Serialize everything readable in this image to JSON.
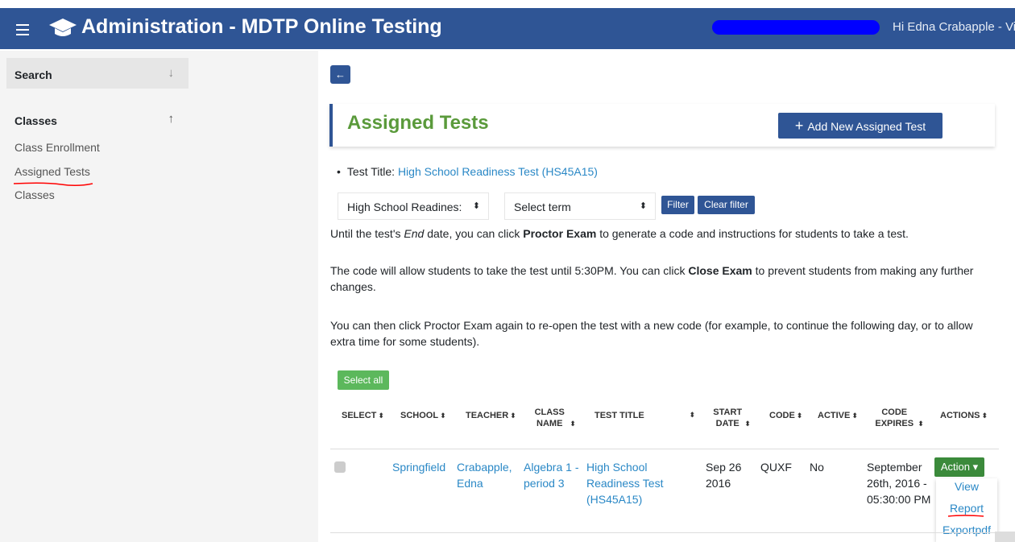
{
  "header": {
    "title": "Administration - MDTP Online Testing",
    "greeting": "Hi Edna Crabapple - Vi"
  },
  "sidebar": {
    "search_label": "Search",
    "search_arrow": "↓",
    "classes_label": "Classes",
    "classes_arrow": "↑",
    "links": [
      "Class Enrollment",
      "Assigned Tests",
      "Classes"
    ]
  },
  "main": {
    "back_arrow": "←",
    "title": "Assigned Tests",
    "add_button": "Add New Assigned Test",
    "add_plus": "+",
    "test_title_label": "Test Title:",
    "test_title_value": "High School Readiness Test (HS45A15)",
    "filter_select_value": "High School Readines:",
    "term_select_value": "Select term",
    "filter_button": "Filter",
    "clear_filter_button": "Clear filter",
    "para1_a": "Until the test's ",
    "para1_em": "End",
    "para1_b": " date, you can click ",
    "para1_strong": "Proctor Exam",
    "para1_c": " to generate a code and instructions for students to take a test.",
    "para2_a": "The code will allow students to take the test until 5:30PM. You can click ",
    "para2_strong": "Close Exam",
    "para2_b": " to prevent students from making any further changes.",
    "para3": "You can then click Proctor Exam again to re-open the test with a new code (for example, to continue the following day, or to allow extra time for some students).",
    "select_all": "Select all"
  },
  "table": {
    "headers": [
      "SELECT",
      "SCHOOL",
      "TEACHER",
      "CLASS NAME",
      "TEST TITLE",
      "START DATE",
      "CODE",
      "ACTIVE",
      "CODE EXPIRES",
      "ACTIONS"
    ],
    "sort_icon": "⬍",
    "row": {
      "school": "Springfield",
      "teacher": "Crabapple, Edna",
      "class_name": "Algebra 1 - period 3",
      "test_title": "High School Readiness Test (HS45A15)",
      "start_date": "Sep 26 2016",
      "code": "QUXF",
      "active": "No",
      "code_expires": "September 26th, 2016 - 05:30:00 PM"
    },
    "action_button": "Action ▾",
    "action_menu": [
      "View",
      "Report",
      "Exportpdf"
    ]
  },
  "colors": {
    "brand": "#2f5595",
    "title_green": "#5a9a3b",
    "link": "#2a88c6",
    "annotation_red": "#ff0000"
  }
}
